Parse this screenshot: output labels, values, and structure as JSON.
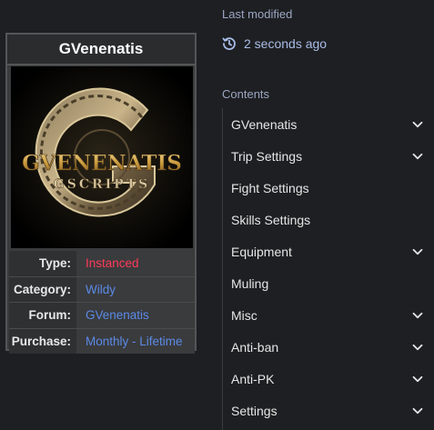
{
  "infobox": {
    "title": "GVenenatis",
    "logo": {
      "line1": "GVENENATIS",
      "line2": "GSCRIPTS",
      "letter": "G"
    },
    "rows": [
      {
        "label": "Type:",
        "value": "Instanced",
        "color": "#ff3b5a"
      },
      {
        "label": "Category:",
        "value": "Wildy",
        "color": "#5b8ae6"
      },
      {
        "label": "Forum:",
        "value": "GVenenatis",
        "color": "#5b8ae6"
      },
      {
        "label": "Purchase:",
        "value": "Monthly - Lifetime",
        "color": "#5b8ae6"
      }
    ]
  },
  "last_modified": {
    "heading": "Last modified",
    "value": "2 seconds ago",
    "icon": "history-icon"
  },
  "contents": {
    "heading": "Contents",
    "items": [
      {
        "label": "GVenenatis",
        "expandable": true
      },
      {
        "label": "Trip Settings",
        "expandable": true
      },
      {
        "label": "Fight Settings",
        "expandable": false
      },
      {
        "label": "Skills Settings",
        "expandable": false
      },
      {
        "label": "Equipment",
        "expandable": true
      },
      {
        "label": "Muling",
        "expandable": false
      },
      {
        "label": "Misc",
        "expandable": true
      },
      {
        "label": "Anti-ban",
        "expandable": true
      },
      {
        "label": "Anti-PK",
        "expandable": true
      },
      {
        "label": "Settings",
        "expandable": true
      }
    ]
  }
}
